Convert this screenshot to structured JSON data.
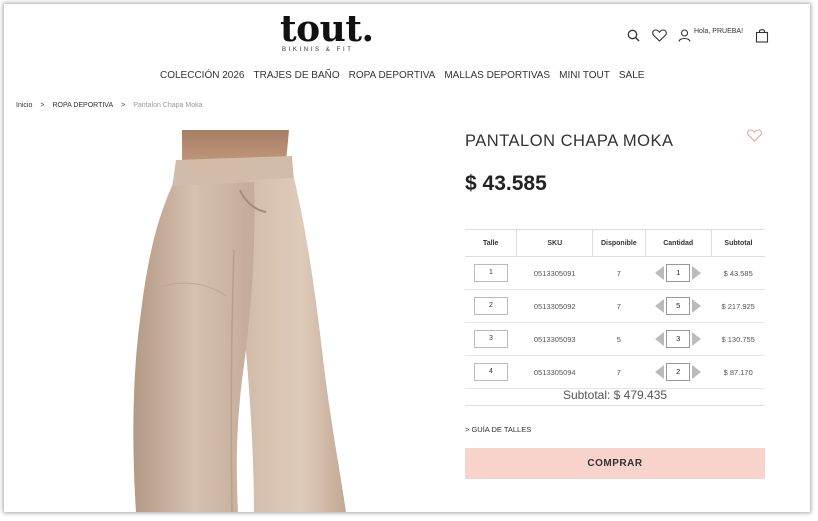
{
  "brand": {
    "name": "tout",
    "dot": ".",
    "tagline": "BIKINIS & FIT"
  },
  "header": {
    "greeting": "Hola, PRUEBA!",
    "icons": [
      "search-icon",
      "heart-icon",
      "user-icon",
      "bag-icon"
    ]
  },
  "nav": {
    "items": [
      "COLECCIÓN 2026",
      "TRAJES DE BAÑO",
      "ROPA DEPORTIVA",
      "MALLAS DEPORTIVAS",
      "MINI TOUT",
      "SALE"
    ]
  },
  "breadcrumb": {
    "home": "Inicio",
    "category": "ROPA DEPORTIVA",
    "current": "Pantalon Chapa Moka",
    "separator": ">"
  },
  "product": {
    "title": "PANTALON CHAPA MOKA",
    "price": "$ 43.585",
    "image_color": "#d9c3b3"
  },
  "table": {
    "headers": [
      "Talle",
      "SKU",
      "Disponible",
      "Cantidad",
      "Subtotal"
    ],
    "rows": [
      {
        "size": "1",
        "sku": "0513305091",
        "available": "7",
        "qty": "1",
        "subtotal": "$ 43.585"
      },
      {
        "size": "2",
        "sku": "0513305092",
        "available": "7",
        "qty": "5",
        "subtotal": "$ 217.925"
      },
      {
        "size": "3",
        "sku": "0513305093",
        "available": "5",
        "qty": "3",
        "subtotal": "$ 130.755"
      },
      {
        "size": "4",
        "sku": "0513305094",
        "available": "7",
        "qty": "2",
        "subtotal": "$ 87.170"
      }
    ]
  },
  "summary": {
    "subtotal": "Subtotal: $ 479.435"
  },
  "links": {
    "size_guide": "> GUÍA DE TALLES"
  },
  "actions": {
    "buy": "COMPRAR"
  },
  "colors": {
    "accent_pink": "#f7d3cc",
    "heart_pink": "#e8a0a0"
  }
}
